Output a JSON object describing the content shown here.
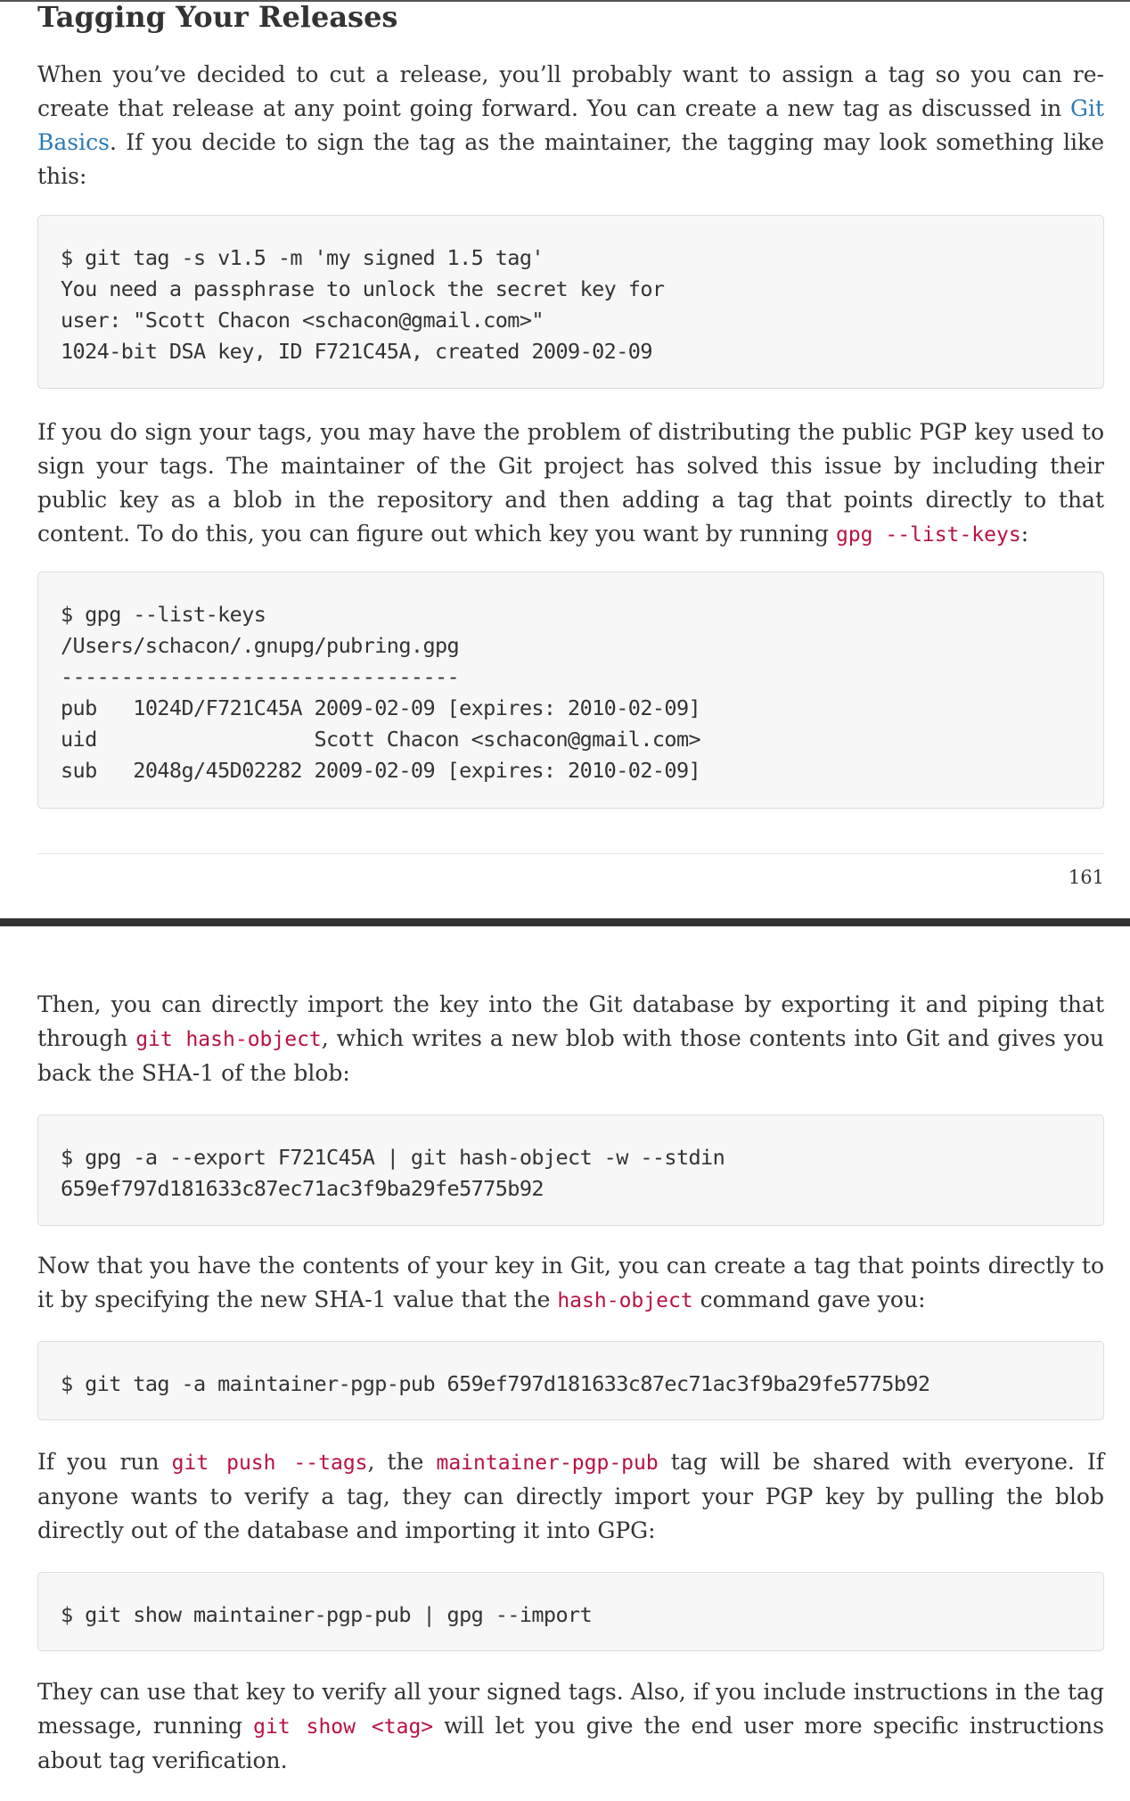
{
  "page1": {
    "section_title": "Tagging Your Releases",
    "para1": {
      "before_link": "When you’ve decided to cut a release, you’ll probably want to assign a tag so you can re-create that release at any point going forward. You can create a new tag as discussed in ",
      "link": "Git Basics",
      "after_link": ". If you decide to sign the tag as the maintainer, the tagging may look something like this:"
    },
    "code1": "$ git tag -s v1.5 -m 'my signed 1.5 tag'\nYou need a passphrase to unlock the secret key for\nuser: \"Scott Chacon <schacon@gmail.com>\"\n1024-bit DSA key, ID F721C45A, created 2009-02-09",
    "para2": {
      "text": "If you do sign your tags, you may have the problem of distributing the public PGP key used to sign your tags. The maintainer of the Git project has solved this issue by including their public key as a blob in the repository and then adding a tag that points directly to that content. To do this, you can figure out which key you want by running ",
      "code": "gpg --list-keys",
      "after": ":"
    },
    "code2": "$ gpg --list-keys\n/Users/schacon/.gnupg/pubring.gpg\n---------------------------------\npub   1024D/F721C45A 2009-02-09 [expires: 2010-02-09]\nuid                  Scott Chacon <schacon@gmail.com>\nsub   2048g/45D02282 2009-02-09 [expires: 2010-02-09]",
    "page_number": "161"
  },
  "page2": {
    "para3": {
      "before": "Then, you can directly import the key into the Git database by exporting it and piping that through ",
      "code": "git hash-object",
      "after": ", which writes a new blob with those contents into Git and gives you back the SHA-1 of the blob:"
    },
    "code3": "$ gpg -a --export F721C45A | git hash-object -w --stdin\n659ef797d181633c87ec71ac3f9ba29fe5775b92",
    "para4": {
      "before": "Now that you have the contents of your key in Git, you can create a tag that points directly to it by specifying the new SHA-1 value that the ",
      "code": "hash-object",
      "after": " command gave you:"
    },
    "code4": "$ git tag -a maintainer-pgp-pub 659ef797d181633c87ec71ac3f9ba29fe5775b92",
    "para5": {
      "before": "If you run ",
      "code1": "git push --tags",
      "middle": ", the ",
      "code2": "maintainer-pgp-pub",
      "after": " tag will be shared with everyone. If anyone wants to verify a tag, they can directly import your PGP key by pulling the blob directly out of the database and importing it into GPG:"
    },
    "code5": "$ git show maintainer-pgp-pub | gpg --import",
    "para6": {
      "before": "They can use that key to verify all your signed tags. Also, if you include instructions in the tag message, running ",
      "code": "git show <tag>",
      "after": " will let you give the end user more specific instructions about tag verification."
    }
  }
}
